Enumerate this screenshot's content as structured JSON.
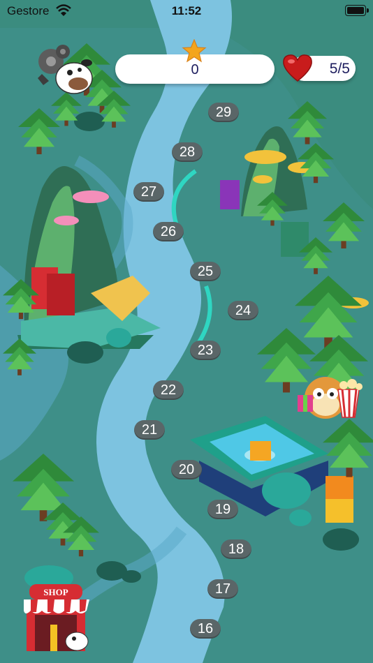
{
  "status_bar": {
    "carrier": "Gestore",
    "time": "11:52"
  },
  "hud": {
    "stars": "0",
    "lives": "5/5"
  },
  "levels": [
    {
      "label": "29"
    },
    {
      "label": "28"
    },
    {
      "label": "27"
    },
    {
      "label": "26"
    },
    {
      "label": "25"
    },
    {
      "label": "24"
    },
    {
      "label": "23"
    },
    {
      "label": "22"
    },
    {
      "label": "21"
    },
    {
      "label": "20"
    },
    {
      "label": "19"
    },
    {
      "label": "18"
    },
    {
      "label": "17"
    },
    {
      "label": "16"
    }
  ],
  "shop": {
    "sign": "SHOP"
  },
  "icons": {
    "settings": "gear-icon",
    "star": "star-icon",
    "heart": "heart-icon",
    "wifi": "wifi-icon",
    "battery": "battery-icon"
  },
  "colors": {
    "ground": "#3e8f88",
    "river": "#7dc3e0",
    "level_bubble": "#5a6668",
    "hud_text": "#1d1d5e",
    "heart": "#c81c1c",
    "star": "#f3a51c"
  }
}
